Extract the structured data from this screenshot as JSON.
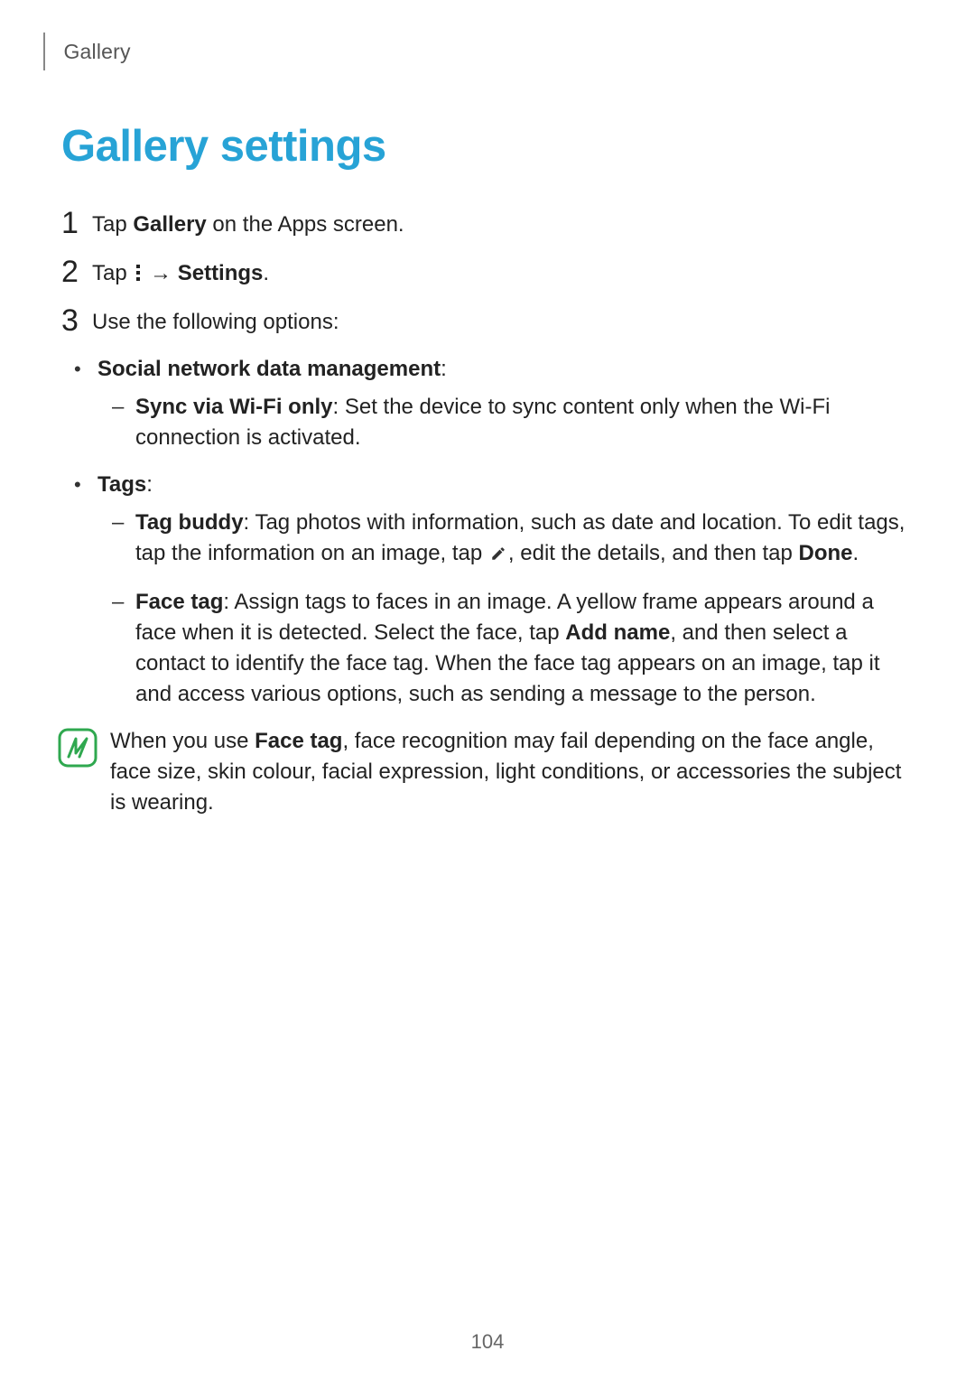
{
  "running_head": "Gallery",
  "title": "Gallery settings",
  "steps": {
    "s1": {
      "num": "1",
      "pre": "Tap ",
      "bold": "Gallery",
      "post": " on the Apps screen."
    },
    "s2": {
      "num": "2",
      "pre": "Tap ",
      "arrow": " → ",
      "bold": "Settings",
      "post": "."
    },
    "s3": {
      "num": "3",
      "text": "Use the following options:"
    }
  },
  "b1": {
    "social": {
      "label": "Social network data management",
      "colon": ":",
      "sync": {
        "label": "Sync via Wi-Fi only",
        "text": ": Set the device to sync content only when the Wi-Fi connection is activated."
      }
    },
    "tags": {
      "label": "Tags",
      "colon": ":",
      "tag_buddy": {
        "label": "Tag buddy",
        "t1": ": Tag photos with information, such as date and location. To edit tags, tap the information on an image, tap ",
        "t2": ", edit the details, and then tap ",
        "done": "Done",
        "t3": "."
      },
      "face_tag": {
        "label": "Face tag",
        "t1": ": Assign tags to faces in an image. A yellow frame appears around a face when it is detected. Select the face, tap ",
        "addname": "Add name",
        "t2": ", and then select a contact to identify the face tag. When the face tag appears on an image, tap it and access various options, such as sending a message to the person."
      }
    }
  },
  "note": {
    "t1": "When you use ",
    "bold": "Face tag",
    "t2": ", face recognition may fail depending on the face angle, face size, skin colour, facial expression, light conditions, or accessories the subject is wearing."
  },
  "page_number": "104"
}
